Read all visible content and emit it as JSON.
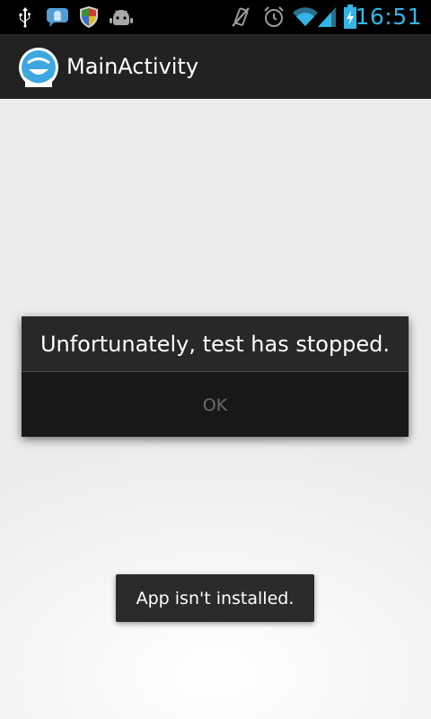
{
  "status_bar": {
    "time": "16:51",
    "time_color": "#33b5e5",
    "notification_icons": [
      "usb-icon",
      "chat-bubble-icon",
      "shield-icon",
      "android-robot-icon"
    ],
    "system_icons": [
      "muted-vibrate-icon",
      "alarm-clock-icon",
      "wifi-icon",
      "signal-icon",
      "battery-charging-icon"
    ]
  },
  "action_bar": {
    "title": "MainActivity",
    "app_icon": "smiley-app-icon"
  },
  "dialog": {
    "message": "Unfortunately, test has stopped.",
    "ok_label": "OK"
  },
  "toast": {
    "message": "App isn't installed."
  }
}
